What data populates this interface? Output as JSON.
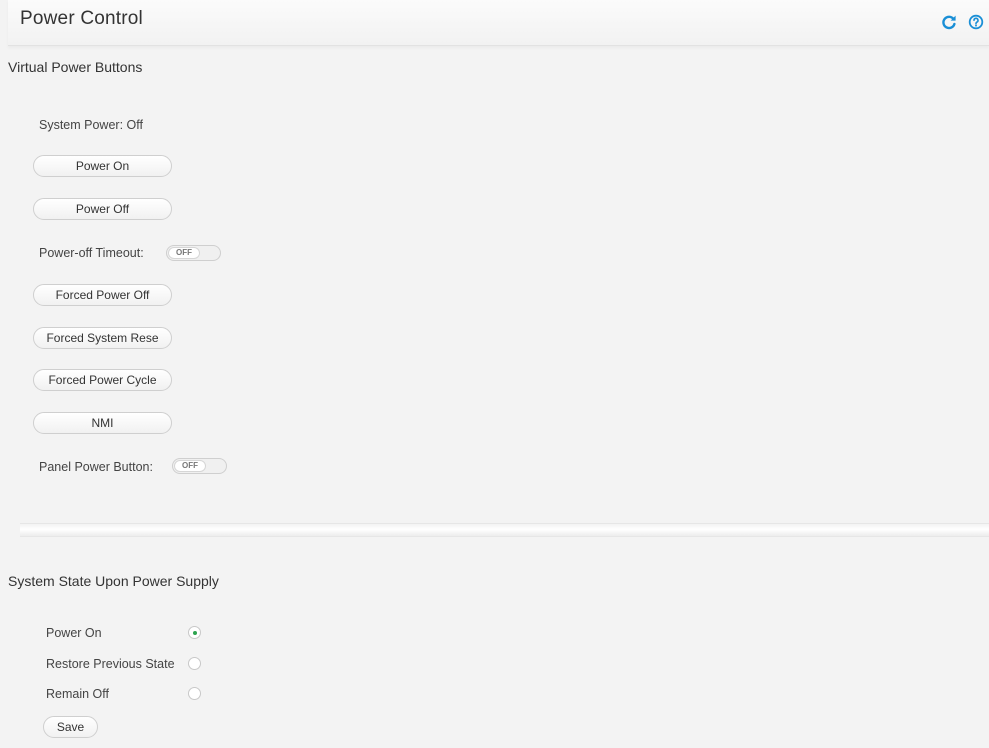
{
  "header": {
    "title": "Power Control",
    "refresh_icon": "refresh-icon",
    "help_icon": "help-icon",
    "icon_color": "#1a8fd6"
  },
  "virtual_power": {
    "section_title": "Virtual Power Buttons",
    "system_power_label": "System Power:",
    "system_power_value": "Off",
    "power_on_label": "Power On",
    "power_off_label": "Power Off",
    "power_off_timeout_label": "Power-off Timeout:",
    "power_off_timeout_state": "OFF",
    "forced_power_off_label": "Forced Power Off",
    "forced_system_reset_label": "Forced System Rese",
    "forced_power_cycle_label": "Forced Power Cycle",
    "nmi_label": "NMI",
    "panel_power_button_label": "Panel Power Button:",
    "panel_power_button_state": "OFF"
  },
  "power_supply": {
    "section_title": "System State Upon Power Supply",
    "options": [
      {
        "label": "Power On",
        "selected": true
      },
      {
        "label": "Restore Previous State",
        "selected": false
      },
      {
        "label": "Remain Off",
        "selected": false
      }
    ],
    "save_label": "Save",
    "accent_color": "#2ea44f"
  }
}
